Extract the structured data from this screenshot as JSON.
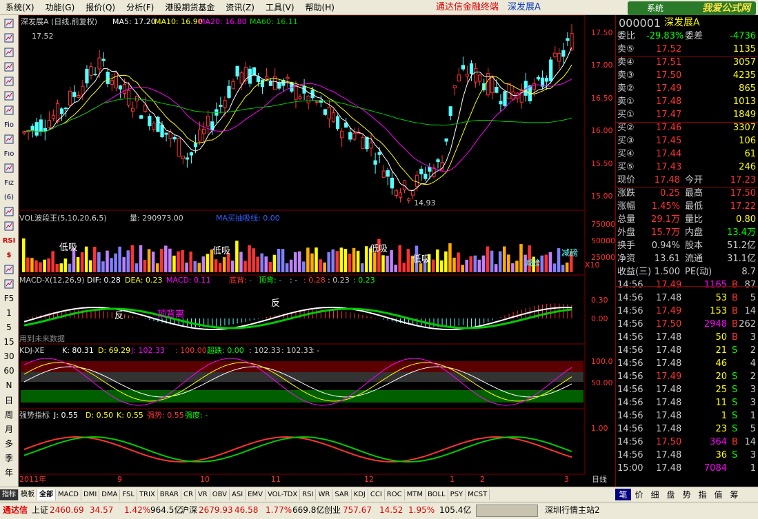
{
  "menu": {
    "items": [
      "系统(X)",
      "功能(G)",
      "报价(Q)",
      "分析(F)",
      "港股期货基金",
      "资讯(Z)",
      "工具(V)",
      "帮助(H)"
    ],
    "brand": "通达信金融终端",
    "brand2": "深发展A",
    "logo": "我爱公式网",
    "logo_url": "www.55188.com",
    "logo_sys": "系统"
  },
  "toolbar": [
    "I",
    "II",
    "III",
    "IV",
    "V",
    "VI",
    "VII",
    "F10",
    "VIII",
    "F9",
    "F10b",
    "F12",
    "(6)",
    "IX",
    "X",
    "RSI",
    "$",
    "XI",
    "XII",
    "F5",
    "1",
    "5",
    "15",
    "30",
    "60",
    "N",
    "日",
    "周",
    "月",
    "多",
    "季",
    "年"
  ],
  "toolbar_labels": [
    "",
    "",
    "",
    "",
    "",
    "",
    "",
    "Fio",
    "",
    "Fıo",
    "",
    "Fız",
    "(6)",
    "",
    "",
    "RSI",
    "$",
    "",
    "",
    "F5",
    "1",
    "5",
    "15",
    "30",
    "60",
    "N",
    "日",
    "周",
    "月",
    "多",
    "季",
    "年"
  ],
  "main": {
    "title": "深发展A (日线,前复权)",
    "ma5": "MA5: 17.20",
    "ma10": "MA10: 16.90",
    "ma20": "MA20: 16.80",
    "ma60": "MA60: 16.11",
    "high_label": "17.52",
    "low_label": "14.93",
    "yticks": [
      "17.50",
      "17.00",
      "16.50",
      "16.00",
      "15.50",
      "15.00"
    ]
  },
  "vol": {
    "title": "VOL波段王(5,10,20,6,5)",
    "vol_label": "量: 290973.00",
    "ma_label": "MA买抽吸线: 0.00",
    "yticks": [
      "75000",
      "50000",
      "25000"
    ],
    "mult": "X10",
    "signals": [
      "低吸",
      "低吸",
      "低吸",
      "低吸"
    ],
    "tag1": "减磅",
    "tag2": "减磅"
  },
  "macd": {
    "title": "MACD-X(12,26,9)",
    "dif": "DIF: 0.28",
    "dea": "DEA: 0.23",
    "macd": "MACD: 0.11",
    "extra1": "底背: -",
    "extra2": "顶背: -",
    "extra3": ": -",
    "extra4": ": 0.28",
    "extra5": ": 0.23",
    "extra6": ": 0.23",
    "yticks": [
      "0.30",
      "0.00"
    ],
    "note": "反",
    "note2": "顶背离",
    "note3": "反",
    "footer": "用到未来数据"
  },
  "kdj": {
    "title": "KDJ-XE",
    "k": "K: 80.31",
    "d": "D: 69.29",
    "j": "J: 102.33",
    "v1": ": 100.00",
    "v2": "超跌: 0.00",
    "v3": ": 102.33",
    "v4": ": 102.33",
    "v5": ": -",
    "yticks": [
      "100.0",
      "50.00"
    ]
  },
  "strong": {
    "title": "强势指标",
    "j": "J: 0.55",
    "d": "D: 0.50",
    "k": "K: 0.55",
    "s": "强势: 0.55",
    "q": "强度: -",
    "yticks": [
      "1.00"
    ]
  },
  "xaxis": {
    "labels": [
      "2011年",
      "9",
      "10",
      "11",
      "12",
      "1",
      "2",
      "3"
    ],
    "right": "日线"
  },
  "quote": {
    "code": "000001",
    "name": "深发展A",
    "wei_bi_label": "委比",
    "wei_bi": "-29.83%",
    "wei_cha_label": "委差",
    "wei_cha": "-4736",
    "sell": [
      {
        "l": "卖⑤",
        "p": "17.52",
        "v": "1135"
      },
      {
        "l": "卖④",
        "p": "17.51",
        "v": "3057"
      },
      {
        "l": "卖③",
        "p": "17.50",
        "v": "4235"
      },
      {
        "l": "卖②",
        "p": "17.49",
        "v": "865"
      },
      {
        "l": "卖①",
        "p": "17.48",
        "v": "1013"
      }
    ],
    "buy": [
      {
        "l": "买①",
        "p": "17.47",
        "v": "1849"
      },
      {
        "l": "买②",
        "p": "17.46",
        "v": "3307"
      },
      {
        "l": "买③",
        "p": "17.45",
        "v": "106"
      },
      {
        "l": "买④",
        "p": "17.44",
        "v": "61"
      },
      {
        "l": "买⑤",
        "p": "17.43",
        "v": "246"
      }
    ],
    "stats": [
      {
        "a": "现价",
        "av": "17.48",
        "b": "今开",
        "bv": "17.23"
      },
      {
        "a": "涨跌",
        "av": "0.25",
        "b": "最高",
        "bv": "17.50"
      },
      {
        "a": "涨幅",
        "av": "1.45%",
        "b": "最低",
        "bv": "17.22"
      },
      {
        "a": "总量",
        "av": "29.1万",
        "b": "量比",
        "bv": "0.80"
      },
      {
        "a": "外盘",
        "av": "15.7万",
        "b": "内盘",
        "bv": "13.4万"
      },
      {
        "a": "换手",
        "av": "0.94%",
        "b": "股本",
        "bv": "51.2亿"
      },
      {
        "a": "净资",
        "av": "13.61",
        "b": "流通",
        "bv": "31.1亿"
      },
      {
        "a": "收益(三)",
        "av": "1.500",
        "b": "PE(动)",
        "bv": "8.7"
      }
    ],
    "ticks": [
      {
        "t": "14:56",
        "p": "17.49",
        "v": "1165",
        "s": "B",
        "n": "87"
      },
      {
        "t": "14:56",
        "p": "17.48",
        "v": "53",
        "s": "B",
        "n": "5"
      },
      {
        "t": "14:56",
        "p": "17.49",
        "v": "153",
        "s": "B",
        "n": "14"
      },
      {
        "t": "14:56",
        "p": "17.50",
        "v": "2948",
        "s": "B",
        "n": "262"
      },
      {
        "t": "14:56",
        "p": "17.48",
        "v": "50",
        "s": "B",
        "n": "3"
      },
      {
        "t": "14:56",
        "p": "17.48",
        "v": "21",
        "s": "S",
        "n": "2"
      },
      {
        "t": "14:56",
        "p": "17.48",
        "v": "46",
        "s": "",
        "n": "4"
      },
      {
        "t": "14:56",
        "p": "17.49",
        "v": "20",
        "s": "S",
        "n": "2"
      },
      {
        "t": "14:56",
        "p": "17.48",
        "v": "25",
        "s": "S",
        "n": "3"
      },
      {
        "t": "14:56",
        "p": "17.48",
        "v": "11",
        "s": "S",
        "n": "3"
      },
      {
        "t": "14:56",
        "p": "17.48",
        "v": "1",
        "s": "S",
        "n": "1"
      },
      {
        "t": "14:56",
        "p": "17.48",
        "v": "23",
        "s": "S",
        "n": "5"
      },
      {
        "t": "14:56",
        "p": "17.50",
        "v": "364",
        "s": "B",
        "n": "14"
      },
      {
        "t": "14:56",
        "p": "17.48",
        "v": "36",
        "s": "S",
        "n": "3"
      },
      {
        "t": "15:00",
        "p": "17.48",
        "v": "7084",
        "s": "",
        "n": "1"
      }
    ]
  },
  "bottom_tabs": [
    "指标",
    "模板",
    "全部",
    "MACD",
    "DMI",
    "DMA",
    "FSL",
    "TRIX",
    "BRAR",
    "CR",
    "VR",
    "OBV",
    "ASI",
    "EMV",
    "VOL-TDX",
    "RSI",
    "WR",
    "SAR",
    "KDJ",
    "CCI",
    "ROC",
    "MTM",
    "BOLL",
    "PSY",
    "MCST"
  ],
  "right_tabs": [
    "笔",
    "价",
    "细",
    "盘",
    "势",
    "指",
    "值",
    "筹"
  ],
  "status": {
    "brand": "通达信",
    "sh_label": "上证",
    "sh": "2460.69",
    "sh_chg": "34.57",
    "sh_pct": "1.42%",
    "sh_amt": "964.5亿",
    "sz_label": "沪深",
    "sz": "2679.93",
    "sz_chg": "46.58",
    "sz_pct": "1.77%",
    "sz_amt": "669.8亿",
    "cy_label": "创业",
    "cy": "757.67",
    "cy_chg": "14.52",
    "cy_pct": "1.95%",
    "cy_amt": "105.4亿",
    "server": "深圳行情主站2"
  },
  "colors": {
    "up": "#ff3232",
    "down": "#54ffff",
    "ma5": "#ffffff",
    "ma10": "#ffff00",
    "ma20": "#ff00ff",
    "ma60": "#00c000",
    "grid": "#800000"
  }
}
